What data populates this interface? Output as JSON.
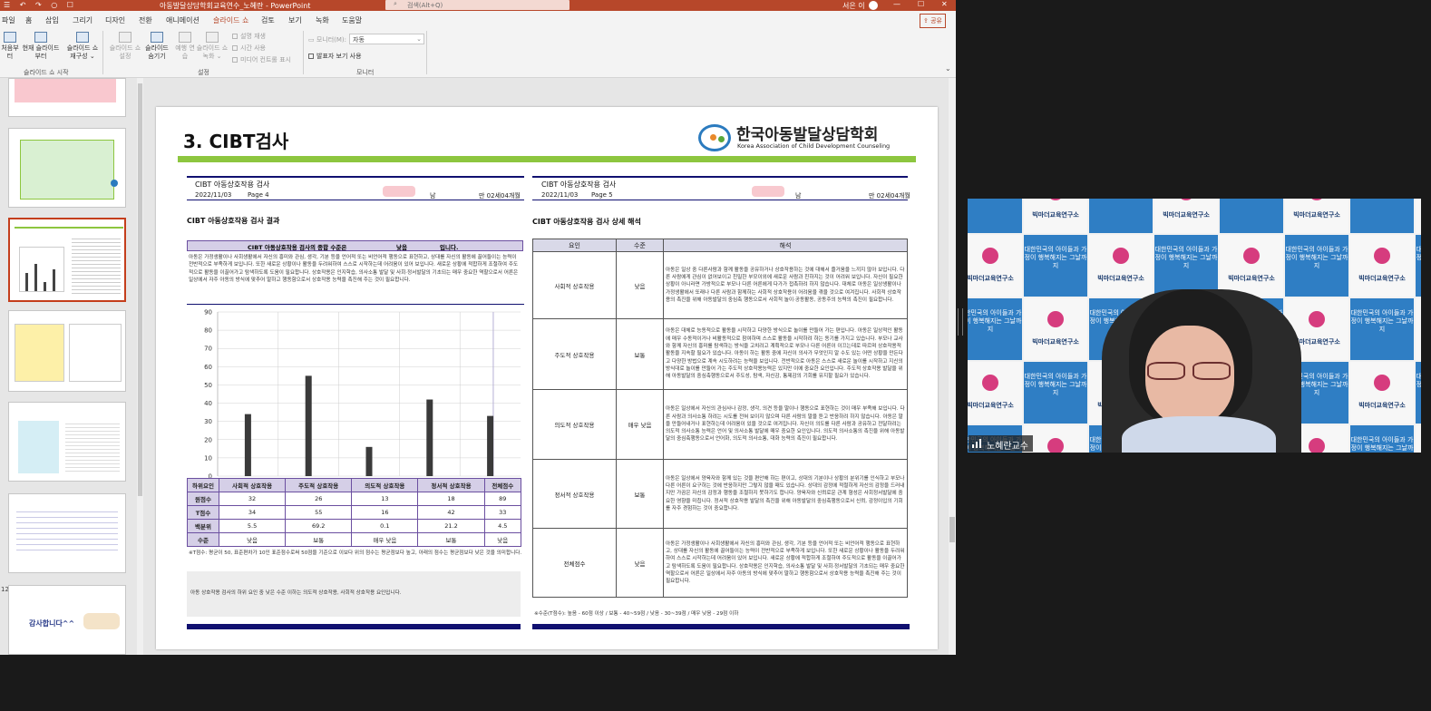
{
  "titlebar": {
    "quick_access": "☰ ↶ ↷ ○ ☐",
    "title": "아동발달상담학회교육연수_노혜란 - PowerPoint",
    "search_placeholder": "검색(Alt+Q)",
    "user": "서은 이",
    "min": "—",
    "max": "☐",
    "close": "✕"
  },
  "menu": {
    "items": [
      "파일",
      "홈",
      "삽입",
      "그리기",
      "디자인",
      "전환",
      "애니메이션",
      "슬라이드 쇼",
      "검토",
      "보기",
      "녹화",
      "도움말"
    ],
    "share": "⇪ 공유"
  },
  "ribbon": {
    "btn_from_start": "처음부터",
    "btn_present_online": "온라인",
    "btn_custom": "슬라이드 쇼 재구성 ⌄",
    "btn_setup": "슬라이드 쇼 설정",
    "btn_hide": "슬라이드 숨기기",
    "btn_rehearse": "예행 연습",
    "btn_record": "슬라이드 쇼 녹화 ⌄",
    "chk_narration": "설명 재생",
    "chk_timing": "시간 사용",
    "chk_media": "미디어 컨트롤 표시",
    "monitor_label": "모니터(M):",
    "monitor_value": "자동",
    "chk_presenter": "발표자 보기 사용",
    "grp_start": "슬라이드 쇼 시작",
    "grp_setup": "설정",
    "grp_monitor": "모니터",
    "btn_from_start2": "현재 슬라이드부터"
  },
  "thumbs": {
    "numbers": [
      "",
      "",
      "",
      "",
      "",
      "",
      "",
      "12"
    ],
    "last_text": "감사합니다^^"
  },
  "slide": {
    "title": "3. CIBT검사",
    "logo_kr": "한국아동발달상담학회",
    "logo_en": "Korea Association of Child Development Counseling",
    "left": {
      "doc_title": "CIBT 아동상호작용 검사",
      "date": "2022/11/03",
      "page": "Page 4",
      "gender": "남",
      "age": "만 02세04개월",
      "section": "CIBT 아동상호작용 검사 결과",
      "summary_head_a": "CIBT 아동상호작용 검사의 종합 수준은",
      "summary_head_b": "낮음",
      "summary_head_c": "입니다.",
      "summary_text": "아동은 가정생활이나 사회생활에서 자신의 흥미와 관심, 생각, 기분 등을 언어적 또는 비언어적 행동으로 표현하고, 상대를 자신의 활동에 끌어들이는 능력이 전반적으로 부족하게 보입니다. 또한 새로운 상황이나 활동을 두려워하여 스스로 시작하는데 어려움이 있어 보입니다. 새로운 상황에 적합하게 조절하여 주도적으로 활동을 이끌어가고 탐색하도록 도움이 필요합니다. 상호작용은 인지학습, 의사소통 발달 및 사회·정서발달의 기초되는 매우 중요한 역할으로서 어른은 일상에서 자주 아동의 방식에 맞추어 말하고 행동함으로서 상호작용 능력을 촉진해 주는 것이 필요합니다.",
      "table_header": [
        "하위요인",
        "사회적 상호작용",
        "주도적 상호작용",
        "의도적 상호작용",
        "정서적 상호작용",
        "전체점수"
      ],
      "rows": [
        {
          "label": "원점수",
          "cells": [
            "32",
            "26",
            "13",
            "18",
            "89"
          ]
        },
        {
          "label": "T점수",
          "cells": [
            "34",
            "55",
            "16",
            "42",
            "33"
          ]
        },
        {
          "label": "백분위",
          "cells": [
            "5.5",
            "69.2",
            "0.1",
            "21.2",
            "4.5"
          ]
        },
        {
          "label": "수준",
          "cells": [
            "낮음",
            "보통",
            "매우 낮음",
            "보통",
            "낮음"
          ]
        }
      ],
      "footnote": "※T점수: 평균이 50, 표준편차가 10인 표준점수로써 50점을 기준으로 이보다 위의 점수는 평균점보다 높고, 아래의 점수는 평균점보다 낮은 것을 의미합니다.",
      "note": "아동 상호작용 검사의 하위 요인 중 낮은 수준 이하는 의도적 상호작용, 사회적 상호작용 요인입니다."
    },
    "right": {
      "doc_title": "CIBT 아동상호작용 검사",
      "date": "2022/11/03",
      "page": "Page 5",
      "gender": "남",
      "age": "만 02세04개월",
      "section": "CIBT 아동상호작용 검사 상세 해석",
      "head": [
        "요인",
        "수준",
        "해석"
      ],
      "rows": [
        {
          "factor": "사회적 상호작용",
          "level": "낮음",
          "text": "아동은 일상 중 다른사람과 함께 활동을 공유하거나 상호작용하는 것에 대해서 즐거움을 느끼지 않아 보입니다. 다른 사람에게 관심이 없어보이고 친밀한 부모이외에 새로운 사람과 친하지는 것이 어려워 보입니다. 자신이 필요한 상황이 아니라면 가방적으로 부모나 다른 어른에게 다가가 접촉하려 하지 않습니다. 대체로 아동은 일상생활이나 가정생활에서 또래나 다른 사람과 함께하는 사회적 상호작용이 어려움을 겪을 것으로 여겨집니다. 사회적 상호작용의 촉진을 위해 아동발달의 중심축 행동으로서 사회적 놀이·공동활동, 공동주의 능력의 촉진이 필요합니다."
        },
        {
          "factor": "주도적 상호작용",
          "level": "보통",
          "text": "아동은 대체로 능동적으로 활동을 시작하고 다양한 방식으로 놀이를 만들어 가는 편입니다. 아동은 일상적인 활동에 매우 수동적이거나 비활동적으로 참여하며 스스로 활동을 시작하려 하는 동기를 가지고 있습니다. 부모나 교사와 함께 자신의 흥미를 탐색하는 방식을 고치려고 계획적으로 부모나 다른 어른이 이끄는데로 따르며 상호작용적 활동을 지속할 필요가 있습니다. 아동이 하는 활동 중에 자신이 의사가 무엇인지 알 수도 있는 어떤 상황을 만든다고 다양한 방법으로 계속 시도하려는 능력을 보입니다. 전반적으로 아동은 스스로 새로운 놀이를 시작하고 지신의 방식대로 놀이를 만들어 가는 주도적 상호작용능력은 있지만 이에 중요한 요인입니다. 주도적 상호작용 발달을 위해 아동발달의 중심축행동으로서 주도성, 탐색, 자신감, 통제감의 기회를 유지할 필요가 있습니다."
        },
        {
          "factor": "의도적 상호작용",
          "level": "매우 낮음",
          "text": "아동은 일상에서 자신의 관심사나 감정, 생각, 의견 등을 말이나 행동으로 표현하는 것이 매우 부족해 보입니다. 다른 사람과 의사소통 하려는 시도를 전혀 보이지 않으며 다른 사람의 말을 듣고 반응하려 하지 않습니다. 아동은 말을 만들어내거나 표현하는데 어려움이 있을 것으로 여겨집니다. 자신이 의도를 다른 사람과 공유하고 전달하려는 의도적 의사소통 능력은 언어 및 의사소통 발달에 매우 중요한 요인입니다. 의도적 의사소통의 촉진을 위해 아동발달의 중심축행동으로서 언어화, 의도적 의사소통, 대화 능력의 촉진이 필요합니다."
        },
        {
          "factor": "정서적 상호작용",
          "level": "보통",
          "text": "아동은 일상에서 양육자와 함께 있는 것을 편안해 하는 편이고, 상대의 기분이나 상황의 분위기를 인식하고 부모나 다른 어른이 요구하는 것에 반응하지만 그렇지 않을 때도 있습니다. 상대의 감정에 적절하게 자신의 감정을 드러내지만 가끔은 자신의 감정과 행동을 조절하지 못하기도 합니다. 양육자와 신뢰로운 관계 형성은 사회정서발달에 중요한 영향을 미칩니다. 정서적 상호작용 발달의 촉진을 위해 아동발달의 중심축행동으로서 신뢰, 감정이입의 기회를 자주 경험하는 것이 중요합니다."
        },
        {
          "factor": "전체점수",
          "level": "낮음",
          "text": "아동은 가정생활이나 사회생활에서 자신의 흥미와 관심, 생각, 기분 등을 언어적 또는 비언어적 행동으로 표현하고, 상대를 자신의 활동에 끌어들이는 능력이 전반적으로 부족하게 보입니다. 또한 새로운 상황이나 활동을 두려워하여 스스로 시작하는데 어려움이 있어 보입니다. 새로운 상황에 적합하게 조절하여 주도적으로 활동을 이끌어가고 탐색하도록 도움이 필요합니다. 상호작용은 인지학습, 의사소통 발달 및 사회·정서발달의 기초되는 매우 중요한 역할으로서 어른은 일상에서 자주 아동의 방식에 맞추어 말하고 행동함으로서 상호작용 능력을 촉진해 주는 것이 필요합니다."
        }
      ],
      "footnote": "※수준(T점수): 높음 - 60점 이상 / 보통 - 40~59점 / 낮음 - 30~39점 / 매우 낮음 - 29점 이하"
    }
  },
  "chart_data": {
    "type": "bar",
    "categories": [
      "사회적 상호작용",
      "주도적 상호작용",
      "의도적 상호작용",
      "정서적 상호작용",
      "전체점수"
    ],
    "values": [
      34,
      55,
      16,
      42,
      33
    ],
    "ylim": [
      0,
      90
    ],
    "yticks": [
      0,
      10,
      20,
      30,
      40,
      50,
      60,
      70,
      80,
      90
    ],
    "bar_color": "#3a3a3a"
  },
  "video": {
    "name": "노혜란교수",
    "banner_org": "빅마더교육연구소",
    "banner_slogan": "대한민국의 아이들과 가정이 행복해지는 그날까지",
    "banner_short": "행복해지는 그날까지",
    "colors": {
      "blue": "#2f7ec4",
      "white": "#f7f7f7"
    }
  }
}
